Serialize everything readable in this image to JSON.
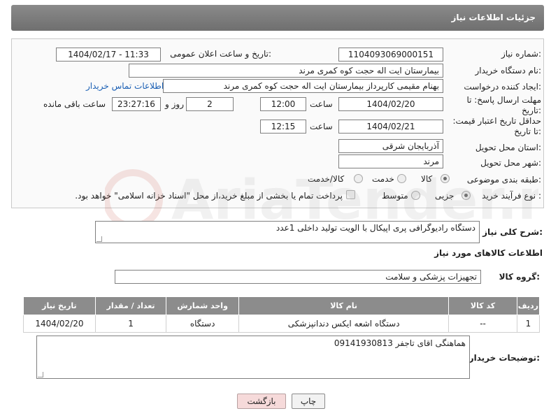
{
  "header": {
    "title": "جزئیات اطلاعات نیاز"
  },
  "form": {
    "need_number_label": "شماره نیاز:",
    "need_number": "1104093069000151",
    "announce_label": "تاریخ و ساعت اعلان عمومی:",
    "announce_value": "1404/02/17 - 11:33",
    "buyer_label": "نام دستگاه خریدار:",
    "buyer_value": "بیمارستان ایت اله حجت کوه کمری مرند",
    "creator_label": "ایجاد کننده درخواست:",
    "creator_value": "بهنام مقیمی کارپرداز بیمارستان ایت اله حجت کوه کمری مرند",
    "contact_link": "اطلاعات تماس خریدار",
    "reply_deadline_label": "مهلت ارسال پاسخ: تا تاریخ:",
    "reply_date": "1404/02/20",
    "time_label": "ساعت",
    "reply_time": "12:00",
    "days_value": "2",
    "days_label": "روز و",
    "remaining_time": "23:27:16",
    "remaining_label": "ساعت باقی مانده",
    "price_deadline_label": "حداقل تاریخ اعتبار قیمت: تا تاریخ:",
    "price_date": "1404/02/21",
    "price_time": "12:15",
    "province_label": "استان محل تحویل:",
    "province_value": "آذربایجان شرقی",
    "city_label": "شهر محل تحویل:",
    "city_value": "مرند",
    "category_label": "طبقه بندی موضوعی:",
    "category_options": [
      "کالا",
      "خدمت",
      "کالا/خدمت"
    ],
    "process_label": "نوع فرآیند خرید :",
    "process_options": [
      "جزیی",
      "متوسط"
    ],
    "payment_note": "پرداخت تمام یا بخشی از مبلغ خرید،از محل \"اسناد خزانه اسلامی\" خواهد بود."
  },
  "description": {
    "label": "شرح کلی نیاز:",
    "value": "دستگاه رادیوگرافی پری اپیکال با الویت تولید داخلی 1عدد"
  },
  "goods_section": {
    "title": "اطلاعات کالاهای مورد نیاز",
    "group_label": "گروه کالا:",
    "group_value": "تجهیزات پزشکی و سلامت"
  },
  "table": {
    "headers": [
      "ردیف",
      "کد کالا",
      "نام کالا",
      "واحد شمارش",
      "تعداد / مقدار",
      "تاریخ نیاز"
    ],
    "rows": [
      [
        "1",
        "--",
        "دستگاه اشعه ایکس دندانپزشکی",
        "دستگاه",
        "1",
        "1404/02/20"
      ]
    ]
  },
  "buyer_notes": {
    "label": "توضیحات خریدار:",
    "value": "هماهنگی اقای تاجفر 09141930813"
  },
  "buttons": {
    "print": "چاپ",
    "back": "بازگشت"
  },
  "watermark": {
    "text": "AriaTender.net"
  }
}
